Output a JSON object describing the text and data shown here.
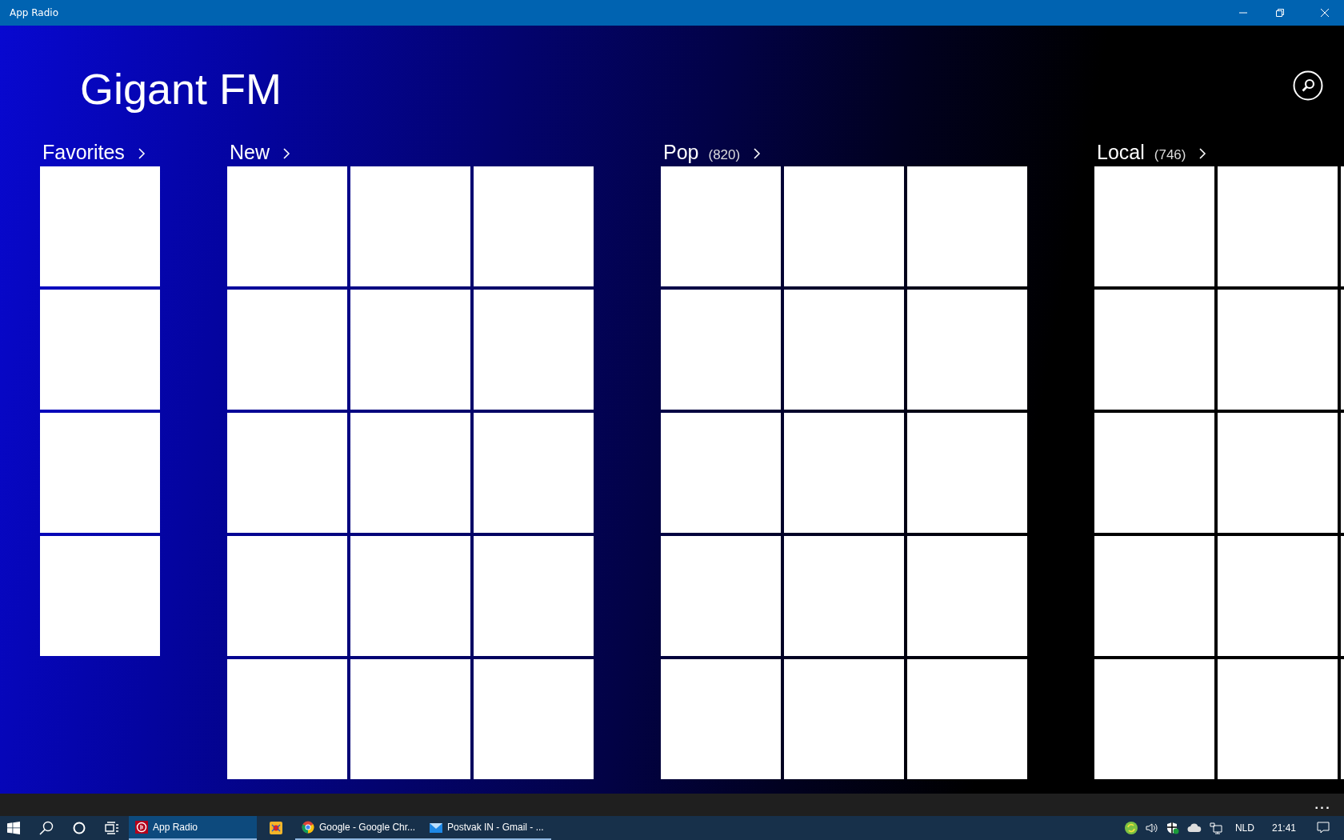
{
  "window": {
    "title": "App Radio"
  },
  "page_title": "Gigant FM",
  "sections": [
    {
      "title": "Favorites",
      "kind": "column",
      "tiles": [
        {
          "kind": "blank"
        },
        {
          "kind": "blank"
        },
        {
          "kind": "blank"
        },
        {
          "kind": "blank"
        }
      ]
    },
    {
      "title": "New",
      "kind": "grid",
      "tiles": [
        {
          "kind": "blank"
        },
        {
          "kind": "blank"
        },
        {
          "kind": "blank"
        },
        {
          "kind": "blank"
        },
        {
          "kind": "blank"
        },
        {
          "kind": "blank"
        },
        {
          "kind": "blank"
        },
        {
          "kind": "blank"
        },
        {
          "kind": "blank"
        },
        {
          "kind": "blank"
        },
        {
          "kind": "blank"
        },
        {
          "kind": "blank"
        },
        {
          "kind": "blank"
        },
        {
          "kind": "blank"
        },
        {
          "kind": "blank"
        }
      ]
    },
    {
      "title": "Pop",
      "count": "(820)",
      "kind": "grid",
      "tiles": [
        {
          "kind": "blank"
        },
        {
          "kind": "blank"
        },
        {
          "kind": "blank"
        },
        {
          "kind": "blank"
        },
        {
          "kind": "blank"
        },
        {
          "kind": "blank"
        },
        {
          "kind": "blank"
        },
        {
          "kind": "blank"
        },
        {
          "kind": "blank"
        },
        {
          "kind": "blank"
        },
        {
          "kind": "blank"
        },
        {
          "kind": "blank"
        },
        {
          "kind": "blank"
        },
        {
          "kind": "blank"
        },
        {
          "kind": "blank"
        }
      ]
    },
    {
      "title": "Local",
      "count": "(746)",
      "kind": "grid",
      "tiles": [
        {
          "kind": "blank"
        },
        {
          "kind": "blank"
        },
        {
          "kind": "blank"
        },
        {
          "kind": "blank"
        },
        {
          "kind": "blank"
        },
        {
          "kind": "blank"
        },
        {
          "kind": "blank"
        },
        {
          "kind": "blank"
        },
        {
          "kind": "blank"
        },
        {
          "kind": "blank"
        },
        {
          "kind": "blank"
        },
        {
          "kind": "blank"
        },
        {
          "kind": "blank"
        },
        {
          "kind": "blank"
        },
        {
          "kind": "blank"
        }
      ]
    }
  ],
  "app_bar": {
    "more": "..."
  },
  "taskbar": {
    "apps": [
      {
        "kind": "radio",
        "label": "App Radio",
        "selected": true,
        "running": true
      },
      {
        "kind": "game",
        "running": false,
        "selected": false
      },
      {
        "kind": "chrome",
        "label": "Google - Google Chr...",
        "running": true,
        "selected": false
      },
      {
        "kind": "mail",
        "label": "Postvak IN - Gmail - ...",
        "running": true,
        "selected": false
      }
    ],
    "language": "NLD",
    "time": "21:41"
  }
}
